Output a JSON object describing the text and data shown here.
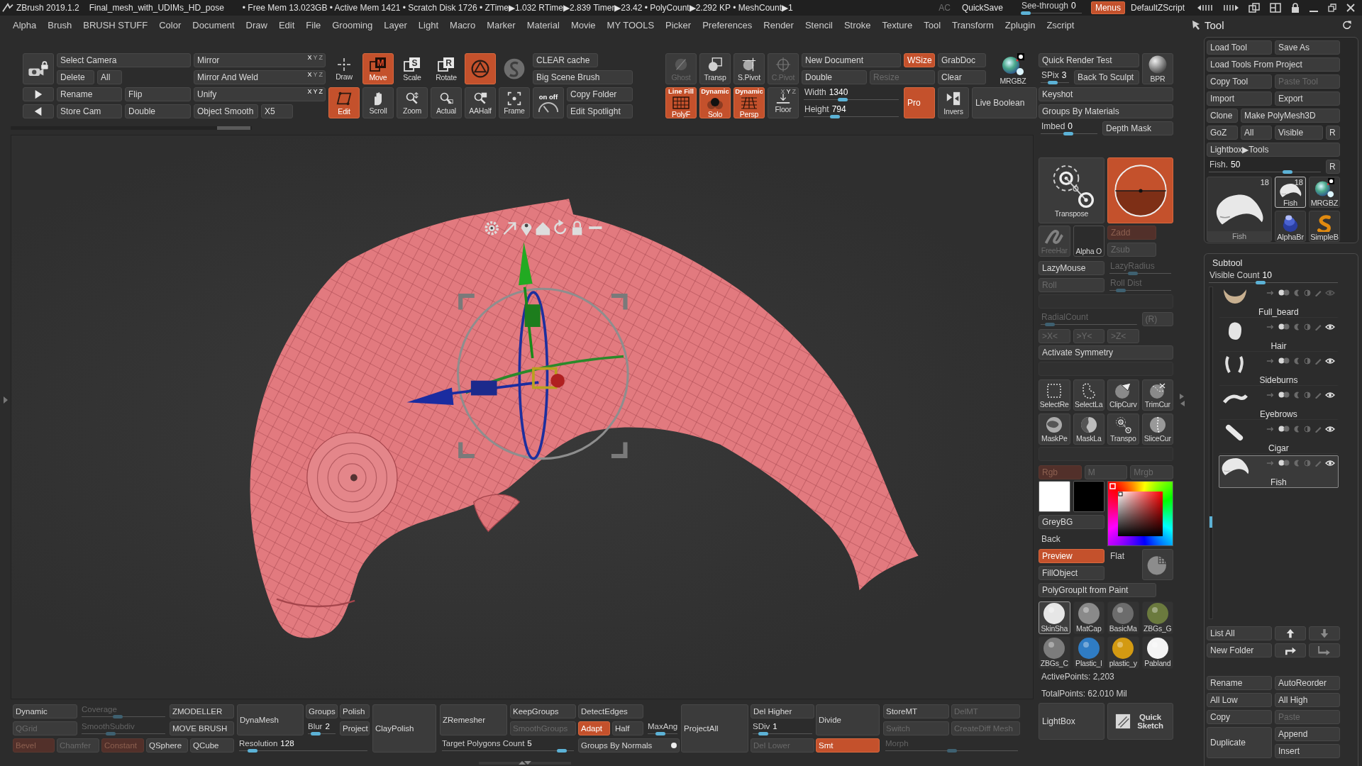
{
  "title_bar": {
    "app": "ZBrush 2019.1.2",
    "file": "Final_mesh_with_UDIMs_HD_pose",
    "stats": "• Free Mem 13.023GB • Active Mem 1421 • Scratch Disk 1726 • ZTime▶1.032 RTime▶2.839 Timer▶23.42 • PolyCount▶2.292 KP • MeshCount▶1",
    "ac": "AC",
    "quicksave": "QuickSave",
    "see_through": {
      "kind": "slider",
      "label": "See-through",
      "value": "0",
      "level": 0,
      "on": false,
      "disabled": false
    },
    "menus": {
      "label": "Menus",
      "on": true
    },
    "script": "DefaultZScript"
  },
  "menu_bar": [
    "Alpha",
    "Brush",
    "BRUSH STUFF",
    "Color",
    "Document",
    "Draw",
    "Edit",
    "File",
    "Grooming",
    "Layer",
    "Light",
    "Macro",
    "Marker",
    "Material",
    "Movie",
    "MY TOOLS",
    "Picker",
    "Preferences",
    "Render",
    "Stencil",
    "Stroke",
    "Texture",
    "Tool",
    "Transform",
    "Zplugin",
    "Zscript"
  ],
  "top_shelf": {
    "groups": [
      {
        "items": [
          {
            "kind": "icon",
            "on": false,
            "disabled": false
          },
          {
            "kind": "button",
            "label": "Select Camera",
            "on": false,
            "disabled": false
          },
          {
            "kind": "button",
            "label": "Mirror",
            "on": false,
            "disabled": false,
            "axes": [
              {
                "label": "X",
                "on": true
              },
              {
                "label": "Y",
                "on": false
              },
              {
                "label": "Z",
                "on": false
              }
            ]
          },
          {
            "kind": "button",
            "label": "Delete",
            "on": false,
            "disabled": false
          },
          {
            "kind": "button",
            "label": "All",
            "on": false,
            "disabled": false
          },
          {
            "kind": "button",
            "label": "Mirror And Weld",
            "on": false,
            "disabled": false,
            "axes": [
              {
                "label": "X",
                "on": true
              },
              {
                "label": "Y",
                "on": false
              },
              {
                "label": "Z",
                "on": false
              }
            ]
          },
          {
            "kind": "icon",
            "on": false,
            "disabled": false
          },
          {
            "kind": "button",
            "label": "Rename",
            "on": false,
            "disabled": false
          },
          {
            "kind": "button",
            "label": "Flip",
            "on": false,
            "disabled": false
          },
          {
            "kind": "button",
            "label": "Unify",
            "on": false,
            "disabled": false,
            "axes": [
              {
                "label": "X",
                "on": true
              },
              {
                "label": "Y",
                "on": true
              },
              {
                "label": "Z",
                "on": true
              }
            ]
          },
          {
            "kind": "icon",
            "on": false,
            "disabled": false
          },
          {
            "kind": "button",
            "label": "Store Cam",
            "on": false,
            "disabled": false
          },
          {
            "kind": "button",
            "label": "Double",
            "on": false,
            "disabled": false
          },
          {
            "kind": "button",
            "label": "Object Smooth",
            "on": false,
            "disabled": false
          },
          {
            "kind": "button",
            "label": "X5",
            "on": false,
            "disabled": false
          }
        ]
      },
      {
        "items": [
          {
            "kind": "icon",
            "label": "Draw",
            "on": false,
            "disabled": false
          },
          {
            "kind": "icon",
            "label": "Move",
            "glyph": "M",
            "on": true,
            "disabled": false
          },
          {
            "kind": "icon",
            "label": "Scale",
            "glyph": "S",
            "on": false,
            "disabled": false
          },
          {
            "kind": "icon",
            "label": "Rotate",
            "glyph": "R",
            "on": false,
            "disabled": false
          },
          {
            "kind": "icon",
            "on": true,
            "disabled": false
          },
          {
            "kind": "icon",
            "on": false,
            "disabled": false
          },
          {
            "kind": "button",
            "label": "CLEAR cache",
            "on": false,
            "disabled": false
          },
          {
            "kind": "button",
            "label": "Big Scene Brush",
            "on": false,
            "disabled": false
          },
          {
            "kind": "icon",
            "label": "Edit",
            "on": true,
            "disabled": false
          },
          {
            "kind": "icon",
            "label": "Scroll",
            "on": false,
            "disabled": false
          },
          {
            "kind": "icon",
            "label": "Zoom",
            "on": false,
            "disabled": false
          },
          {
            "kind": "icon",
            "label": "Actual",
            "on": false,
            "disabled": false
          },
          {
            "kind": "icon",
            "label": "AAHalf",
            "on": false,
            "disabled": false
          },
          {
            "kind": "icon",
            "label": "Frame",
            "on": false,
            "disabled": false
          },
          {
            "kind": "icon",
            "caption": "on off",
            "on": false,
            "disabled": false
          },
          {
            "kind": "button",
            "label": "Copy Folder",
            "on": false,
            "disabled": false
          },
          {
            "kind": "button",
            "label": "Edit Spotlight",
            "on": false,
            "disabled": false
          }
        ]
      },
      {
        "items": [
          {
            "kind": "icon",
            "label": "Ghost",
            "on": false,
            "disabled": true
          },
          {
            "kind": "icon",
            "label": "Transp",
            "on": false,
            "disabled": false
          },
          {
            "kind": "icon",
            "label": "S.Pivot",
            "on": false,
            "disabled": false
          },
          {
            "kind": "icon",
            "label": "C.Pivot",
            "on": false,
            "disabled": true
          },
          {
            "kind": "icon",
            "caption": "Line Fill",
            "label": "PolyF",
            "on": true,
            "disabled": false
          },
          {
            "kind": "icon",
            "caption": "Dynamic",
            "label": "Solo",
            "on": true,
            "disabled": false
          },
          {
            "kind": "icon",
            "caption": "Dynamic",
            "label": "Persp",
            "on": true,
            "disabled": false
          },
          {
            "kind": "icon",
            "label": "Floor",
            "on": false,
            "disabled": false,
            "axes": [
              {
                "label": "X",
                "on": false
              },
              {
                "label": "Y",
                "on": true
              },
              {
                "label": "Z",
                "on": false
              }
            ]
          }
        ]
      },
      {
        "items": [
          {
            "kind": "button",
            "label": "New Document",
            "on": false,
            "disabled": false
          },
          {
            "kind": "button",
            "label": "WSize",
            "on": true,
            "disabled": false
          },
          {
            "kind": "button",
            "label": "GrabDoc",
            "on": false,
            "disabled": false
          },
          {
            "kind": "icon",
            "label": "MRGBZ",
            "on": false,
            "disabled": false
          },
          {
            "kind": "button",
            "label": "Double",
            "on": false,
            "disabled": false
          },
          {
            "kind": "button",
            "label": "Resize",
            "on": false,
            "disabled": true
          },
          {
            "kind": "button",
            "label": "Clear",
            "on": false,
            "disabled": false
          },
          {
            "kind": "slider",
            "label": "Width",
            "value": "1340",
            "level": 0.4,
            "on": false,
            "disabled": false
          },
          {
            "kind": "button",
            "label": "Pro",
            "on": true,
            "disabled": false
          },
          {
            "kind": "icon",
            "label": "Invers",
            "on": false,
            "disabled": false
          },
          {
            "kind": "button",
            "label": "Live Boolean",
            "on": false,
            "disabled": false
          },
          {
            "kind": "slider",
            "label": "Height",
            "value": "794",
            "level": 0.31,
            "on": false,
            "disabled": false
          }
        ]
      }
    ]
  },
  "right_shelf": {
    "groups": [
      {
        "items": [
          {
            "kind": "button",
            "label": "Quick Render Test",
            "on": false,
            "disabled": false
          },
          {
            "kind": "icon",
            "label": "BPR",
            "on": false,
            "disabled": false
          },
          {
            "kind": "slider",
            "label": "SPix",
            "value": "3",
            "level": 0.37,
            "on": false,
            "disabled": false
          },
          {
            "kind": "button",
            "label": "Back To Sculpt",
            "on": false,
            "disabled": false
          },
          {
            "kind": "button",
            "label": "Keyshot",
            "on": false,
            "disabled": false
          },
          {
            "kind": "button",
            "label": "Groups By Materials",
            "on": false,
            "disabled": false
          },
          {
            "kind": "slider",
            "label": "Imbed",
            "value": "0",
            "level": 0.49,
            "on": false,
            "disabled": false
          },
          {
            "kind": "button",
            "label": "Depth Mask",
            "on": false,
            "disabled": false
          }
        ]
      },
      {
        "items": [
          {
            "kind": "icon",
            "label": "Transpose",
            "on": false,
            "disabled": false
          },
          {
            "kind": "icon",
            "on": true,
            "disabled": false
          }
        ]
      },
      {
        "items": [
          {
            "kind": "icon",
            "label": "FreeHar",
            "on": false,
            "disabled": true
          },
          {
            "kind": "icon",
            "label": "Alpha O",
            "on": false,
            "disabled": false
          },
          {
            "kind": "button",
            "label": "Zadd",
            "on": true,
            "disabled": true
          },
          {
            "kind": "button",
            "label": "Zsub",
            "on": false,
            "disabled": true
          }
        ]
      },
      {
        "items": [
          {
            "kind": "button",
            "label": "LazyMouse",
            "on": false,
            "disabled": false
          },
          {
            "kind": "slider",
            "label": "LazyRadius",
            "level": 0.35,
            "on": false,
            "disabled": true
          },
          {
            "kind": "button",
            "label": "Roll",
            "on": false,
            "disabled": true
          },
          {
            "kind": "slider",
            "label": "Roll Dist",
            "level": 0.12,
            "on": false,
            "disabled": true
          }
        ]
      },
      {
        "items": [
          {
            "kind": "slider",
            "label": "RadialCount",
            "level": 0.05,
            "on": false,
            "disabled": true
          },
          {
            "kind": "button",
            "label": "(R)",
            "on": false,
            "disabled": true
          },
          {
            "kind": "button",
            "label": ">X<",
            "on": false,
            "disabled": true
          },
          {
            "kind": "button",
            "label": ">Y<",
            "on": false,
            "disabled": true
          },
          {
            "kind": "button",
            "label": ">Z<",
            "on": false,
            "disabled": true
          }
        ]
      },
      {
        "items": [
          {
            "kind": "button",
            "label": "Activate Symmetry",
            "on": false,
            "disabled": false
          }
        ]
      },
      {
        "items": [
          {
            "kind": "icon",
            "label": "SelectRe",
            "on": false,
            "disabled": false
          },
          {
            "kind": "icon",
            "label": "SelectLa",
            "on": false,
            "disabled": false
          },
          {
            "kind": "icon",
            "label": "ClipCurv",
            "on": false,
            "disabled": false
          },
          {
            "kind": "icon",
            "label": "TrimCur",
            "on": false,
            "disabled": false
          },
          {
            "kind": "icon",
            "label": "MaskPe",
            "on": false,
            "disabled": false
          },
          {
            "kind": "icon",
            "label": "MaskLa",
            "on": false,
            "disabled": false
          },
          {
            "kind": "icon",
            "label": "Transpo",
            "on": false,
            "disabled": false
          },
          {
            "kind": "icon",
            "label": "SliceCur",
            "on": false,
            "disabled": false
          }
        ]
      },
      {
        "items": [
          {
            "kind": "button",
            "label": "Rgb",
            "on": true,
            "disabled": true
          },
          {
            "kind": "button",
            "label": "M",
            "on": false,
            "disabled": true
          },
          {
            "kind": "button",
            "label": "Mrgb",
            "on": false,
            "disabled": true
          }
        ]
      },
      {
        "items": [
          {
            "kind": "swatch",
            "color": "#ffffff"
          },
          {
            "kind": "swatch",
            "color": "#000000"
          },
          {
            "kind": "picker"
          },
          {
            "kind": "button",
            "label": "GreyBG",
            "on": false,
            "disabled": false
          },
          {
            "kind": "text",
            "label": "Back",
            "on": false,
            "disabled": false
          },
          {
            "kind": "button",
            "label": "Preview",
            "on": true,
            "disabled": false
          },
          {
            "kind": "text",
            "label": "Flat",
            "on": false,
            "disabled": false
          },
          {
            "kind": "icon",
            "on": false,
            "disabled": false
          },
          {
            "kind": "button",
            "label": "FillObject",
            "on": false,
            "disabled": false
          }
        ]
      },
      {
        "items": [
          {
            "kind": "button",
            "label": "PolyGroupIt from Paint",
            "on": false,
            "disabled": false
          }
        ]
      },
      {
        "items": [
          {
            "kind": "material",
            "label": "SkinSha",
            "color": "#e6e6e6",
            "selected": true
          },
          {
            "kind": "material",
            "label": "MatCap",
            "color": "#8a8a8a",
            "selected": false
          },
          {
            "kind": "material",
            "label": "BasicMa",
            "color": "#6c6c6c",
            "selected": false
          },
          {
            "kind": "material",
            "label": "ZBGs_G",
            "color": "#6b7a3e",
            "selected": false
          },
          {
            "kind": "material",
            "label": "ZBGs_C",
            "color": "#7c7c7c",
            "selected": false
          },
          {
            "kind": "material",
            "label": "Plastic_l",
            "color": "#2f7cc4",
            "selected": false
          },
          {
            "kind": "material",
            "label": "plastic_y",
            "color": "#d39a12",
            "selected": false
          },
          {
            "kind": "material",
            "label": "Pabland",
            "color": "#f4f4f4",
            "selected": false
          }
        ]
      },
      {
        "items": [
          {
            "kind": "text",
            "label": "ActivePoints: 2,203",
            "on": false,
            "disabled": false
          },
          {
            "kind": "text",
            "label": "TotalPoints: 62.010 Mil",
            "on": false,
            "disabled": false
          }
        ]
      },
      {
        "items": [
          {
            "kind": "button",
            "label": "LightBox",
            "on": false,
            "disabled": false
          },
          {
            "kind": "icon",
            "label": "Quick Sketch",
            "on": false,
            "disabled": false
          }
        ]
      }
    ]
  },
  "bottom_shelf": {
    "groups": [
      {
        "items": [
          {
            "kind": "button",
            "label": "Dynamic",
            "on": false,
            "disabled": false
          },
          {
            "kind": "slider",
            "label": "Coverage",
            "level": 0.42,
            "on": false,
            "disabled": true
          },
          {
            "kind": "button",
            "label": "ZMODELLER",
            "on": false,
            "disabled": false
          },
          {
            "kind": "button",
            "label": "QGrid",
            "on": false,
            "disabled": true
          },
          {
            "kind": "slider",
            "label": "SmoothSubdiv",
            "level": 0.33,
            "on": false,
            "disabled": true
          },
          {
            "kind": "button",
            "label": "MOVE BRUSH",
            "on": false,
            "disabled": false
          },
          {
            "kind": "button",
            "label": "Bevel",
            "on": true,
            "disabled": true
          },
          {
            "kind": "button",
            "label": "Chamfer",
            "on": false,
            "disabled": true
          },
          {
            "kind": "button",
            "label": "Constant",
            "on": true,
            "disabled": true
          },
          {
            "kind": "button",
            "label": "QSphere",
            "on": false,
            "disabled": false
          },
          {
            "kind": "button",
            "label": "QCube",
            "on": false,
            "disabled": false
          }
        ]
      },
      {
        "items": [
          {
            "kind": "button",
            "label": "DynaMesh",
            "on": false,
            "disabled": false
          },
          {
            "kind": "button",
            "label": "Groups",
            "on": false,
            "disabled": false
          },
          {
            "kind": "button",
            "label": "Polish",
            "on": false,
            "disabled": false
          },
          {
            "kind": "slider",
            "label": "Blur",
            "value": "2",
            "level": 0.15,
            "on": false,
            "disabled": false
          },
          {
            "kind": "button",
            "label": "Project",
            "on": false,
            "disabled": false
          },
          {
            "kind": "slider",
            "label": "Resolution",
            "value": "128",
            "level": 0.07,
            "on": false,
            "disabled": false
          }
        ]
      },
      {
        "items": [
          {
            "kind": "button",
            "label": "ClayPolish",
            "on": false,
            "disabled": false
          }
        ]
      },
      {
        "items": [
          {
            "kind": "button",
            "label": "ZRemesher",
            "on": false,
            "disabled": false
          },
          {
            "kind": "button",
            "label": "KeepGroups",
            "on": false,
            "disabled": false
          },
          {
            "kind": "button",
            "label": "SmoothGroups",
            "on": false,
            "disabled": true
          },
          {
            "kind": "slider",
            "label": "Target Polygons Count",
            "value": "5",
            "level": 0.94,
            "on": false,
            "disabled": false
          }
        ]
      },
      {
        "items": [
          {
            "kind": "button",
            "label": "DetectEdges",
            "on": false,
            "disabled": false
          },
          {
            "kind": "button",
            "label": "Adapt",
            "on": true,
            "disabled": false
          },
          {
            "kind": "button",
            "label": "Half",
            "on": false,
            "disabled": false
          },
          {
            "kind": "slider",
            "label": "MaxAng",
            "level": 0.4,
            "on": false,
            "disabled": false
          },
          {
            "kind": "switch",
            "label": "Groups By Normals",
            "on": true,
            "disabled": false
          }
        ]
      },
      {
        "items": [
          {
            "kind": "button",
            "label": "ProjectAll",
            "on": false,
            "disabled": false
          }
        ]
      },
      {
        "items": [
          {
            "kind": "button",
            "label": "Del Higher",
            "on": false,
            "disabled": false
          },
          {
            "kind": "slider",
            "label": "SDiv",
            "value": "1",
            "level": 0.12,
            "on": false,
            "disabled": false
          },
          {
            "kind": "button",
            "label": "Del Lower",
            "on": false,
            "disabled": true
          }
        ]
      },
      {
        "items": [
          {
            "kind": "button",
            "label": "Divide",
            "on": false,
            "disabled": false
          },
          {
            "kind": "button",
            "label": "Smt",
            "on": true,
            "disabled": false
          }
        ]
      },
      {
        "items": [
          {
            "kind": "button",
            "label": "StoreMT",
            "on": false,
            "disabled": false
          },
          {
            "kind": "button",
            "label": "DelMT",
            "on": false,
            "disabled": true
          },
          {
            "kind": "button",
            "label": "Switch",
            "on": false,
            "disabled": true
          },
          {
            "kind": "button",
            "label": "CreateDiff Mesh",
            "on": false,
            "disabled": true
          },
          {
            "kind": "slider",
            "label": "Morph",
            "level": 0.5,
            "on": false,
            "disabled": true
          }
        ]
      }
    ]
  },
  "tool_panel": {
    "title": "Tool",
    "buttons": [
      {
        "kind": "button",
        "label": "Load Tool",
        "on": false,
        "disabled": false
      },
      {
        "kind": "button",
        "label": "Save As",
        "on": false,
        "disabled": false
      },
      {
        "kind": "button",
        "label": "Load Tools From Project",
        "on": false,
        "disabled": false
      },
      {
        "kind": "button",
        "label": "Copy Tool",
        "on": false,
        "disabled": false
      },
      {
        "kind": "button",
        "label": "Paste Tool",
        "on": false,
        "disabled": true
      },
      {
        "kind": "button",
        "label": "Import",
        "on": false,
        "disabled": false
      },
      {
        "kind": "button",
        "label": "Export",
        "on": false,
        "disabled": false
      },
      {
        "kind": "button",
        "label": "Clone",
        "on": false,
        "disabled": false
      },
      {
        "kind": "button",
        "label": "Make PolyMesh3D",
        "on": false,
        "disabled": false
      },
      {
        "kind": "button",
        "label": "GoZ",
        "on": false,
        "disabled": false
      },
      {
        "kind": "button",
        "label": "All",
        "on": false,
        "disabled": false
      },
      {
        "kind": "button",
        "label": "Visible",
        "on": false,
        "disabled": false
      },
      {
        "kind": "button",
        "label": "R",
        "on": false,
        "disabled": false
      },
      {
        "kind": "button",
        "label": "Lightbox▶Tools",
        "on": false,
        "disabled": false
      },
      {
        "kind": "slider",
        "label": "Fish.",
        "value": "50",
        "level": 0.72,
        "on": false,
        "disabled": false
      },
      {
        "kind": "button",
        "label": "R",
        "on": false,
        "disabled": false
      }
    ],
    "tools": [
      {
        "kind": "preview",
        "label": "Fish",
        "count": "18",
        "selected": false
      },
      {
        "kind": "thumb",
        "label": "Fish",
        "count": "18",
        "selected": true
      },
      {
        "kind": "thumb",
        "label": "MRGBZ",
        "selected": false
      },
      {
        "kind": "thumb",
        "label": "AlphaBr",
        "selected": false
      },
      {
        "kind": "thumb",
        "label": "SimpleB",
        "selected": false
      }
    ],
    "subtool": {
      "title": "Subtool",
      "visible_count": {
        "kind": "slider",
        "label": "Visible Count",
        "value": "10",
        "level": 0.39,
        "on": false,
        "disabled": false
      },
      "items": [
        {
          "name": "Full_beard",
          "selected": false,
          "visible": false
        },
        {
          "name": "Hair",
          "selected": false,
          "visible": true
        },
        {
          "name": "Sideburns",
          "selected": false,
          "visible": true
        },
        {
          "name": "Eyebrows",
          "selected": false,
          "visible": true
        },
        {
          "name": "Cigar",
          "selected": false,
          "visible": true
        },
        {
          "name": "Fish",
          "selected": true,
          "visible": true
        }
      ],
      "actions": [
        {
          "kind": "button",
          "label": "List All",
          "on": false,
          "disabled": false
        },
        {
          "kind": "icon",
          "on": false,
          "disabled": false
        },
        {
          "kind": "icon",
          "on": false,
          "disabled": true
        },
        {
          "kind": "button",
          "label": "New Folder",
          "on": false,
          "disabled": false
        },
        {
          "kind": "icon",
          "on": false,
          "disabled": false
        },
        {
          "kind": "icon",
          "on": false,
          "disabled": true
        },
        {
          "kind": "button",
          "label": "Rename",
          "on": false,
          "disabled": false
        },
        {
          "kind": "button",
          "label": "AutoReorder",
          "on": false,
          "disabled": false
        },
        {
          "kind": "button",
          "label": "All Low",
          "on": false,
          "disabled": false
        },
        {
          "kind": "button",
          "label": "All High",
          "on": false,
          "disabled": false
        },
        {
          "kind": "button",
          "label": "Copy",
          "on": false,
          "disabled": false
        },
        {
          "kind": "button",
          "label": "Paste",
          "on": false,
          "disabled": true
        },
        {
          "kind": "button",
          "label": "Append",
          "on": false,
          "disabled": false
        },
        {
          "kind": "button",
          "label": "Duplicate",
          "on": false,
          "disabled": false
        },
        {
          "kind": "button",
          "label": "Insert",
          "on": false,
          "disabled": false
        }
      ]
    }
  }
}
